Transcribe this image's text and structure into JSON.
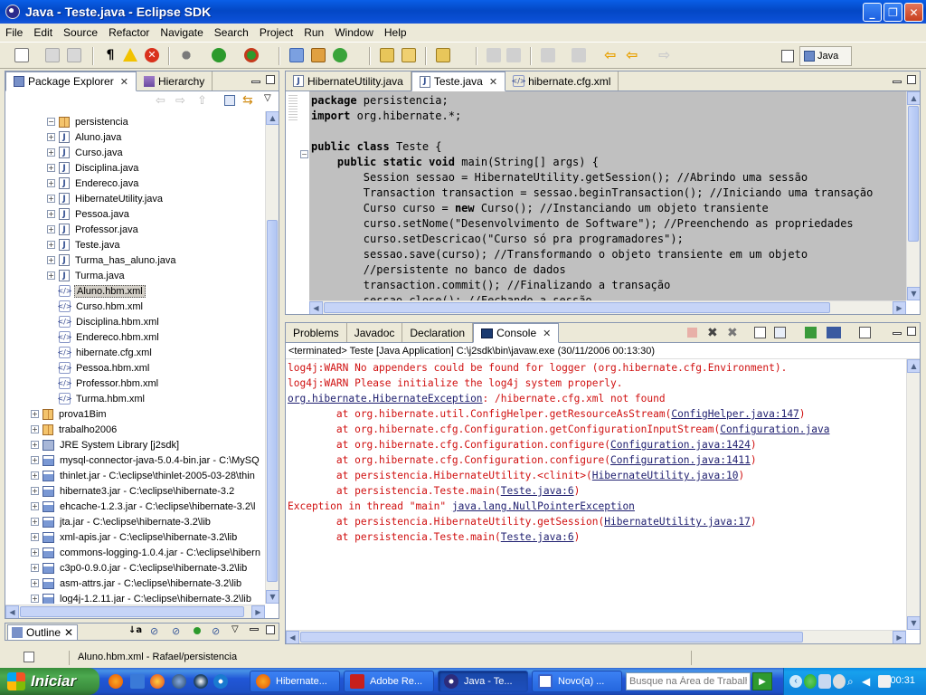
{
  "window": {
    "title": "Java - Teste.java - Eclipse SDK"
  },
  "menu": [
    "File",
    "Edit",
    "Source",
    "Refactor",
    "Navigate",
    "Search",
    "Project",
    "Run",
    "Window",
    "Help"
  ],
  "perspective": {
    "label": "Java"
  },
  "explorer": {
    "tabs": [
      {
        "label": "Package Explorer"
      },
      {
        "label": "Hierarchy"
      }
    ],
    "tree": [
      {
        "label": "persistencia",
        "icon": "package-icon",
        "twisty": "−"
      },
      {
        "label": "Aluno.java",
        "icon": "java-file-icon",
        "twisty": "+"
      },
      {
        "label": "Curso.java",
        "icon": "java-file-icon",
        "twisty": "+"
      },
      {
        "label": "Disciplina.java",
        "icon": "java-file-icon",
        "twisty": "+"
      },
      {
        "label": "Endereco.java",
        "icon": "java-file-icon",
        "twisty": "+"
      },
      {
        "label": "HibernateUtility.java",
        "icon": "java-file-icon",
        "twisty": "+"
      },
      {
        "label": "Pessoa.java",
        "icon": "java-file-icon",
        "twisty": "+"
      },
      {
        "label": "Professor.java",
        "icon": "java-file-icon",
        "twisty": "+"
      },
      {
        "label": "Teste.java",
        "icon": "java-file-icon",
        "twisty": "+"
      },
      {
        "label": "Turma_has_aluno.java",
        "icon": "java-file-icon",
        "twisty": "+"
      },
      {
        "label": "Turma.java",
        "icon": "java-file-icon",
        "twisty": "+"
      },
      {
        "label": "Aluno.hbm.xml",
        "icon": "xml-file-icon",
        "twisty": ""
      },
      {
        "label": "Curso.hbm.xml",
        "icon": "xml-file-icon",
        "twisty": ""
      },
      {
        "label": "Disciplina.hbm.xml",
        "icon": "xml-file-icon",
        "twisty": ""
      },
      {
        "label": "Endereco.hbm.xml",
        "icon": "xml-file-icon",
        "twisty": ""
      },
      {
        "label": "hibernate.cfg.xml",
        "icon": "xml-file-icon",
        "twisty": ""
      },
      {
        "label": "Pessoa.hbm.xml",
        "icon": "xml-file-icon",
        "twisty": ""
      },
      {
        "label": "Professor.hbm.xml",
        "icon": "xml-file-icon",
        "twisty": ""
      },
      {
        "label": "Turma.hbm.xml",
        "icon": "xml-file-icon",
        "twisty": ""
      },
      {
        "label": "prova1Bim",
        "icon": "package-icon",
        "twisty": "+"
      },
      {
        "label": "trabalho2006",
        "icon": "package-icon",
        "twisty": "+"
      },
      {
        "label": "JRE System Library [j2sdk]",
        "icon": "library-icon",
        "twisty": "+"
      },
      {
        "label": "mysql-connector-java-5.0.4-bin.jar - C:\\MySQ",
        "icon": "jar-icon",
        "twisty": "+"
      },
      {
        "label": "thinlet.jar - C:\\eclipse\\thinlet-2005-03-28\\thin",
        "icon": "jar-icon",
        "twisty": "+"
      },
      {
        "label": "hibernate3.jar - C:\\eclipse\\hibernate-3.2",
        "icon": "jar-icon",
        "twisty": "+"
      },
      {
        "label": "ehcache-1.2.3.jar - C:\\eclipse\\hibernate-3.2\\l",
        "icon": "jar-icon",
        "twisty": "+"
      },
      {
        "label": "jta.jar - C:\\eclipse\\hibernate-3.2\\lib",
        "icon": "jar-icon",
        "twisty": "+"
      },
      {
        "label": "xml-apis.jar - C:\\eclipse\\hibernate-3.2\\lib",
        "icon": "jar-icon",
        "twisty": "+"
      },
      {
        "label": "commons-logging-1.0.4.jar - C:\\eclipse\\hibern",
        "icon": "jar-icon",
        "twisty": "+"
      },
      {
        "label": "c3p0-0.9.0.jar - C:\\eclipse\\hibernate-3.2\\lib",
        "icon": "jar-icon",
        "twisty": "+"
      },
      {
        "label": "asm-attrs.jar - C:\\eclipse\\hibernate-3.2\\lib",
        "icon": "jar-icon",
        "twisty": "+"
      },
      {
        "label": "log4j-1.2.11.jar - C:\\eclipse\\hibernate-3.2\\lib",
        "icon": "jar-icon",
        "twisty": "+"
      }
    ]
  },
  "editor": {
    "tabs": [
      {
        "label": "HibernateUtility.java",
        "icon": "java-file-icon"
      },
      {
        "label": "Teste.java",
        "icon": "java-file-icon"
      },
      {
        "label": "hibernate.cfg.xml",
        "icon": "xml-file-icon"
      }
    ],
    "lines": [
      "package persistencia;",
      "import org.hibernate.*;",
      "",
      "public class Teste {",
      "    public static void main(String[] args) {",
      "        Session sessao = HibernateUtility.getSession(); //Abrindo uma sessão",
      "        Transaction transaction = sessao.beginTransaction(); //Iniciando uma transação",
      "        Curso curso = new Curso(); //Instanciando um objeto transiente",
      "        curso.setNome(\"Desenvolvimento de Software\"); //Preenchendo as propriedades",
      "        curso.setDescricao(\"Curso só pra programadores\");",
      "        sessao.save(curso); //Transformando o objeto transiente em um objeto",
      "        //persistente no banco de dados",
      "        transaction.commit(); //Finalizando a transação",
      "        sessao.close(); //Fechando a sessão"
    ]
  },
  "console": {
    "tabs": [
      {
        "label": "Problems"
      },
      {
        "label": "Javadoc"
      },
      {
        "label": "Declaration"
      },
      {
        "label": "Console"
      }
    ],
    "header": "<terminated> Teste [Java Application] C:\\j2sdk\\bin\\javaw.exe (30/11/2006 00:13:30)",
    "lines": [
      {
        "text": "log4j:WARN No appenders could be found for logger (org.hibernate.cfg.Environment).",
        "link": ""
      },
      {
        "text": "log4j:WARN Please initialize the log4j system properly.",
        "link": ""
      },
      {
        "text": ": /hibernate.cfg.xml not found",
        "link": "org.hibernate.HibernateException",
        "link_first": true
      },
      {
        "text": "        at org.hibernate.util.ConfigHelper.getResourceAsStream(",
        "link": "ConfigHelper.java:147",
        "suffix": ")"
      },
      {
        "text": "        at org.hibernate.cfg.Configuration.getConfigurationInputStream(",
        "link": "Configuration.java",
        "suffix": ""
      },
      {
        "text": "        at org.hibernate.cfg.Configuration.configure(",
        "link": "Configuration.java:1424",
        "suffix": ")"
      },
      {
        "text": "        at org.hibernate.cfg.Configuration.configure(",
        "link": "Configuration.java:1411",
        "suffix": ")"
      },
      {
        "text": "        at persistencia.HibernateUtility.<clinit>(",
        "link": "HibernateUtility.java:10",
        "suffix": ")"
      },
      {
        "text": "        at persistencia.Teste.main(",
        "link": "Teste.java:6",
        "suffix": ")"
      },
      {
        "text": "Exception in thread \"main\" ",
        "link": "java.lang.NullPointerException",
        "suffix": ""
      },
      {
        "text": "        at persistencia.HibernateUtility.getSession(",
        "link": "HibernateUtility.java:17",
        "suffix": ")"
      },
      {
        "text": "        at persistencia.Teste.main(",
        "link": "Teste.java:6",
        "suffix": ")"
      }
    ]
  },
  "outline": {
    "tab": "Outline"
  },
  "status": {
    "text": "Aluno.hbm.xml - Rafael/persistencia"
  },
  "taskbar": {
    "start": "Iniciar",
    "tasks": [
      {
        "label": "Hibernate...",
        "icon": "firefox-icon",
        "color": "#e66000"
      },
      {
        "label": "Adobe Re...",
        "icon": "acrobat-icon",
        "color": "#c8201c"
      },
      {
        "label": "Java - Te...",
        "icon": "eclipse-icon",
        "color": "#2c2c7c"
      },
      {
        "label": "Novo(a) ...",
        "icon": "document-icon",
        "color": "#3a62c8"
      }
    ],
    "search_placeholder": "Busque na Área de Trabalho",
    "clock": "00:31"
  }
}
